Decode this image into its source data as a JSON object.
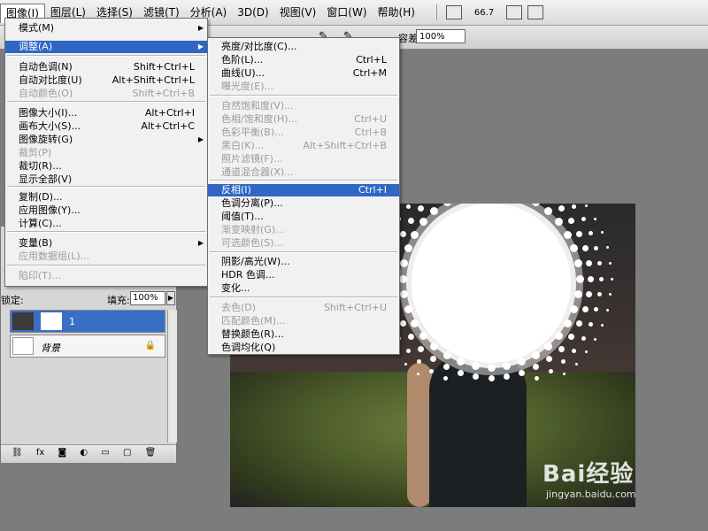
{
  "menubar": {
    "items": [
      "图像(I)",
      "图层(L)",
      "选择(S)",
      "滤镜(T)",
      "分析(A)",
      "3D(D)",
      "视图(V)",
      "窗口(W)",
      "帮助(H)"
    ],
    "zoom": "66.7"
  },
  "options": {
    "tolerance_label": "容差:",
    "tolerance": "100%"
  },
  "image_menu": [
    {
      "label": "模式(M)",
      "shortcut": "",
      "arrow": true,
      "disabled": false,
      "highlight": false
    },
    {
      "label": "调整(A)",
      "shortcut": "",
      "arrow": true,
      "disabled": false,
      "highlight": true
    },
    {
      "label": "自动色调(N)",
      "shortcut": "Shift+Ctrl+L",
      "arrow": false,
      "disabled": false,
      "highlight": false
    },
    {
      "label": "自动对比度(U)",
      "shortcut": "Alt+Shift+Ctrl+L",
      "arrow": false,
      "disabled": false,
      "highlight": false
    },
    {
      "label": "自动颜色(O)",
      "shortcut": "Shift+Ctrl+B",
      "arrow": false,
      "disabled": true,
      "highlight": false
    },
    {
      "label": "图像大小(I)...",
      "shortcut": "Alt+Ctrl+I",
      "arrow": false,
      "disabled": false,
      "highlight": false
    },
    {
      "label": "画布大小(S)...",
      "shortcut": "Alt+Ctrl+C",
      "arrow": false,
      "disabled": false,
      "highlight": false
    },
    {
      "label": "图像旋转(G)",
      "shortcut": "",
      "arrow": true,
      "disabled": false,
      "highlight": false
    },
    {
      "label": "裁剪(P)",
      "shortcut": "",
      "arrow": false,
      "disabled": true,
      "highlight": false
    },
    {
      "label": "裁切(R)...",
      "shortcut": "",
      "arrow": false,
      "disabled": false,
      "highlight": false
    },
    {
      "label": "显示全部(V)",
      "shortcut": "",
      "arrow": false,
      "disabled": false,
      "highlight": false
    },
    {
      "label": "复制(D)...",
      "shortcut": "",
      "arrow": false,
      "disabled": false,
      "highlight": false
    },
    {
      "label": "应用图像(Y)...",
      "shortcut": "",
      "arrow": false,
      "disabled": false,
      "highlight": false
    },
    {
      "label": "计算(C)...",
      "shortcut": "",
      "arrow": false,
      "disabled": false,
      "highlight": false
    },
    {
      "label": "变量(B)",
      "shortcut": "",
      "arrow": true,
      "disabled": false,
      "highlight": false
    },
    {
      "label": "应用数据组(L)...",
      "shortcut": "",
      "arrow": false,
      "disabled": true,
      "highlight": false
    },
    {
      "label": "陷印(T)...",
      "shortcut": "",
      "arrow": false,
      "disabled": true,
      "highlight": false
    }
  ],
  "adjust_menu": [
    {
      "label": "亮度/对比度(C)...",
      "shortcut": "",
      "disabled": false,
      "highlight": false
    },
    {
      "label": "色阶(L)...",
      "shortcut": "Ctrl+L",
      "disabled": false,
      "highlight": false
    },
    {
      "label": "曲线(U)...",
      "shortcut": "Ctrl+M",
      "disabled": false,
      "highlight": false
    },
    {
      "label": "曝光度(E)...",
      "shortcut": "",
      "disabled": true,
      "highlight": false
    },
    {
      "label": "自然饱和度(V)...",
      "shortcut": "",
      "disabled": true,
      "highlight": false
    },
    {
      "label": "色相/饱和度(H)...",
      "shortcut": "Ctrl+U",
      "disabled": true,
      "highlight": false
    },
    {
      "label": "色彩平衡(B)...",
      "shortcut": "Ctrl+B",
      "disabled": true,
      "highlight": false
    },
    {
      "label": "黑白(K)...",
      "shortcut": "Alt+Shift+Ctrl+B",
      "disabled": true,
      "highlight": false
    },
    {
      "label": "照片滤镜(F)...",
      "shortcut": "",
      "disabled": true,
      "highlight": false
    },
    {
      "label": "通道混合器(X)...",
      "shortcut": "",
      "disabled": true,
      "highlight": false
    },
    {
      "label": "反相(I)",
      "shortcut": "Ctrl+I",
      "disabled": false,
      "highlight": true
    },
    {
      "label": "色调分离(P)...",
      "shortcut": "",
      "disabled": false,
      "highlight": false
    },
    {
      "label": "阈值(T)...",
      "shortcut": "",
      "disabled": false,
      "highlight": false
    },
    {
      "label": "渐变映射(G)...",
      "shortcut": "",
      "disabled": true,
      "highlight": false
    },
    {
      "label": "可选颜色(S)...",
      "shortcut": "",
      "disabled": true,
      "highlight": false
    },
    {
      "label": "阴影/高光(W)...",
      "shortcut": "",
      "disabled": false,
      "highlight": false
    },
    {
      "label": "HDR 色调...",
      "shortcut": "",
      "disabled": false,
      "highlight": false
    },
    {
      "label": "变化...",
      "shortcut": "",
      "disabled": false,
      "highlight": false
    },
    {
      "label": "去色(D)",
      "shortcut": "Shift+Ctrl+U",
      "disabled": true,
      "highlight": false
    },
    {
      "label": "匹配颜色(M)...",
      "shortcut": "",
      "disabled": true,
      "highlight": false
    },
    {
      "label": "替换颜色(R)...",
      "shortcut": "",
      "disabled": false,
      "highlight": false
    },
    {
      "label": "色调均化(Q)",
      "shortcut": "",
      "disabled": false,
      "highlight": false
    }
  ],
  "layers": {
    "lock_label": "锁定:",
    "fill_label": "填充:",
    "fill": "100%",
    "rows": [
      {
        "name": "1",
        "selected": true
      },
      {
        "name": "背景",
        "selected": false
      }
    ],
    "bottom_icons": [
      "link-icon",
      "fx-icon",
      "mask-icon",
      "adjustment-icon",
      "folder-icon",
      "new-layer-icon",
      "trash-icon"
    ]
  },
  "watermark": {
    "title": "Bai经验",
    "url": "jingyan.baidu.com"
  }
}
